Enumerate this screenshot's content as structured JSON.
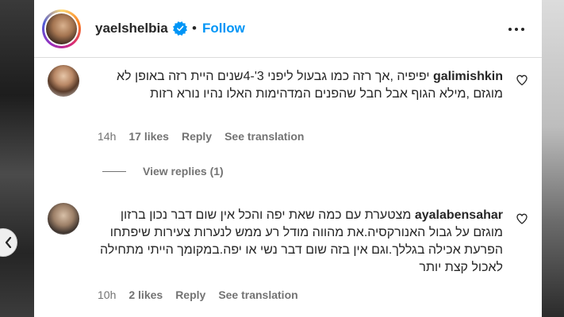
{
  "post": {
    "username": "yaelshelbia",
    "separator": "•",
    "follow_label": "Follow"
  },
  "comments": [
    {
      "username": "galimishkin",
      "text": "יפיפיה ,אך רזה כמו גבעול ליפני 3'-4שנים היית רזה באופן לא מוגזם ,מילא הגוף אבל חבל שהפנים המדהימות האלו נהיו נורא רזות",
      "time": "14h",
      "likes": "17 likes",
      "reply_label": "Reply",
      "translate_label": "See translation"
    },
    {
      "username": "ayalabensahar",
      "text": "מצטערת עם כמה שאת יפה והכל אין שום דבר נכון ברזון מוגזם על גבול האנורקסיה.את מהווה מודל רע ממש לנערות צעירות שיפתחו הפרעת אכילה בגללך.וגם אין בזה שום דבר נשי או יפה.במקומך הייתי מתחילה לאכול קצת יותר",
      "time": "10h",
      "likes": "2 likes",
      "reply_label": "Reply",
      "translate_label": "See translation"
    }
  ],
  "view_replies_label": "View replies (1)",
  "icons": {
    "more": "more-options-icon",
    "verified": "verified-badge-icon",
    "heart": "heart-outline-icon",
    "carousel": "chevron-left-icon"
  },
  "colors": {
    "link": "#0095f6",
    "secondary_text": "#737373",
    "verified": "#0095f6"
  }
}
